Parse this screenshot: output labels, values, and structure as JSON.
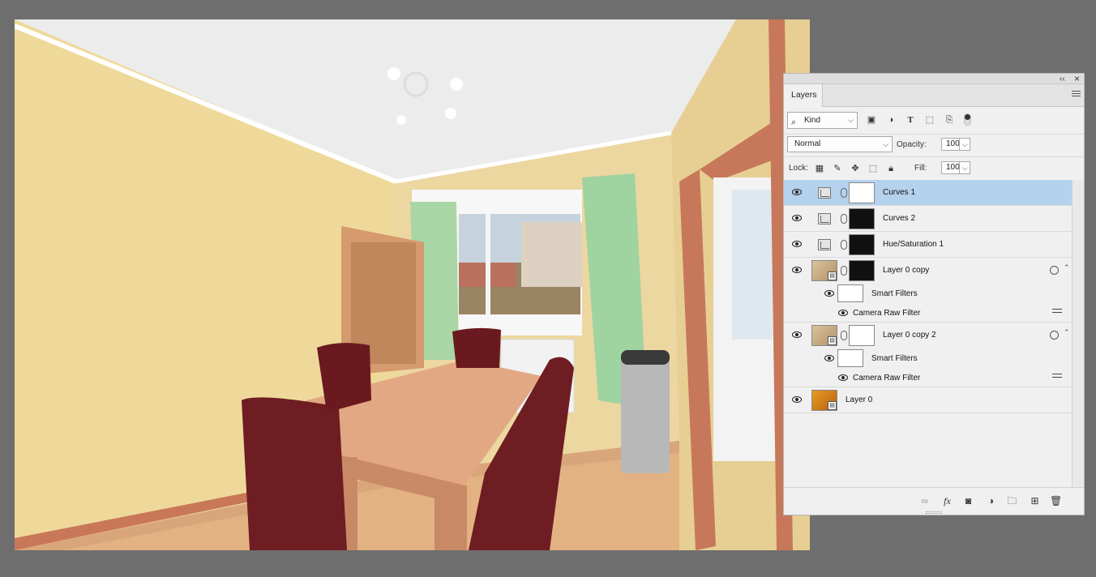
{
  "panel": {
    "tab_label": "Layers",
    "collapse_glyph": "‹‹",
    "close_glyph": "×",
    "filter": {
      "kind_label": "Kind",
      "icons": [
        "image-filter-icon",
        "adjustment-filter-icon",
        "type-filter-icon",
        "shape-filter-icon",
        "smart-object-filter-icon"
      ]
    },
    "blend_mode": "Normal",
    "opacity_label": "Opacity:",
    "opacity_value": "100%",
    "lock_label": "Lock:",
    "fill_label": "Fill:",
    "fill_value": "100%"
  },
  "layers": [
    {
      "name": "Curves 1",
      "type": "adjustment",
      "selected": true
    },
    {
      "name": "Curves 2",
      "type": "adjustment",
      "selected": false
    },
    {
      "name": "Hue/Saturation 1",
      "type": "adjustment",
      "selected": false
    },
    {
      "name": "Layer 0 copy",
      "type": "smart-object",
      "selected": false
    },
    {
      "name": "Smart Filters",
      "type": "smart-filters"
    },
    {
      "name": "Camera Raw Filter",
      "type": "filter"
    },
    {
      "name": "Layer 0 copy 2",
      "type": "smart-object",
      "selected": false
    },
    {
      "name": "Smart Filters",
      "type": "smart-filters"
    },
    {
      "name": "Camera Raw Filter",
      "type": "filter"
    },
    {
      "name": "Layer 0",
      "type": "smart-object",
      "selected": false
    }
  ],
  "type_glyph": "T",
  "fx_glyph": "fx",
  "colors": {
    "selected_row": "#b4d2ee",
    "panel_bg": "#f0f0f0",
    "workspace_bg": "#6e6e6e"
  }
}
